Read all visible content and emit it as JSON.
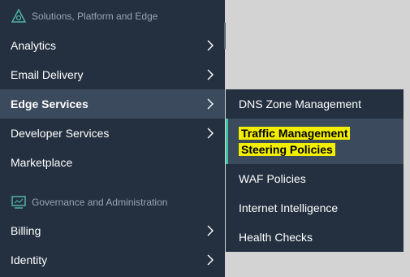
{
  "menu": {
    "sections": [
      {
        "title": "Solutions, Platform and Edge",
        "icon": "platform-triangle-icon"
      },
      {
        "title": "Governance and Administration",
        "icon": "governance-monitor-icon"
      }
    ],
    "items": [
      {
        "label": "Analytics",
        "has_submenu": true
      },
      {
        "label": "Email Delivery",
        "has_submenu": true
      },
      {
        "label": "Edge Services",
        "has_submenu": true,
        "active": true
      },
      {
        "label": "Developer Services",
        "has_submenu": true
      },
      {
        "label": "Marketplace",
        "has_submenu": false
      },
      {
        "label": "Billing",
        "has_submenu": true
      },
      {
        "label": "Identity",
        "has_submenu": true
      }
    ]
  },
  "submenu": {
    "items": [
      {
        "label": "DNS Zone Management"
      },
      {
        "label": "Traffic Management",
        "label_line2": "Steering Policies",
        "selected": true,
        "highlighted": true
      },
      {
        "label": "WAF Policies"
      },
      {
        "label": "Internet Intelligence"
      },
      {
        "label": "Health Checks"
      }
    ]
  },
  "colors": {
    "menu_bg": "#243040",
    "active_bg": "#3b4a5c",
    "selection_accent": "#40c4a6",
    "highlight": "#f2ee00",
    "page_bg": "#d3d3d3"
  }
}
